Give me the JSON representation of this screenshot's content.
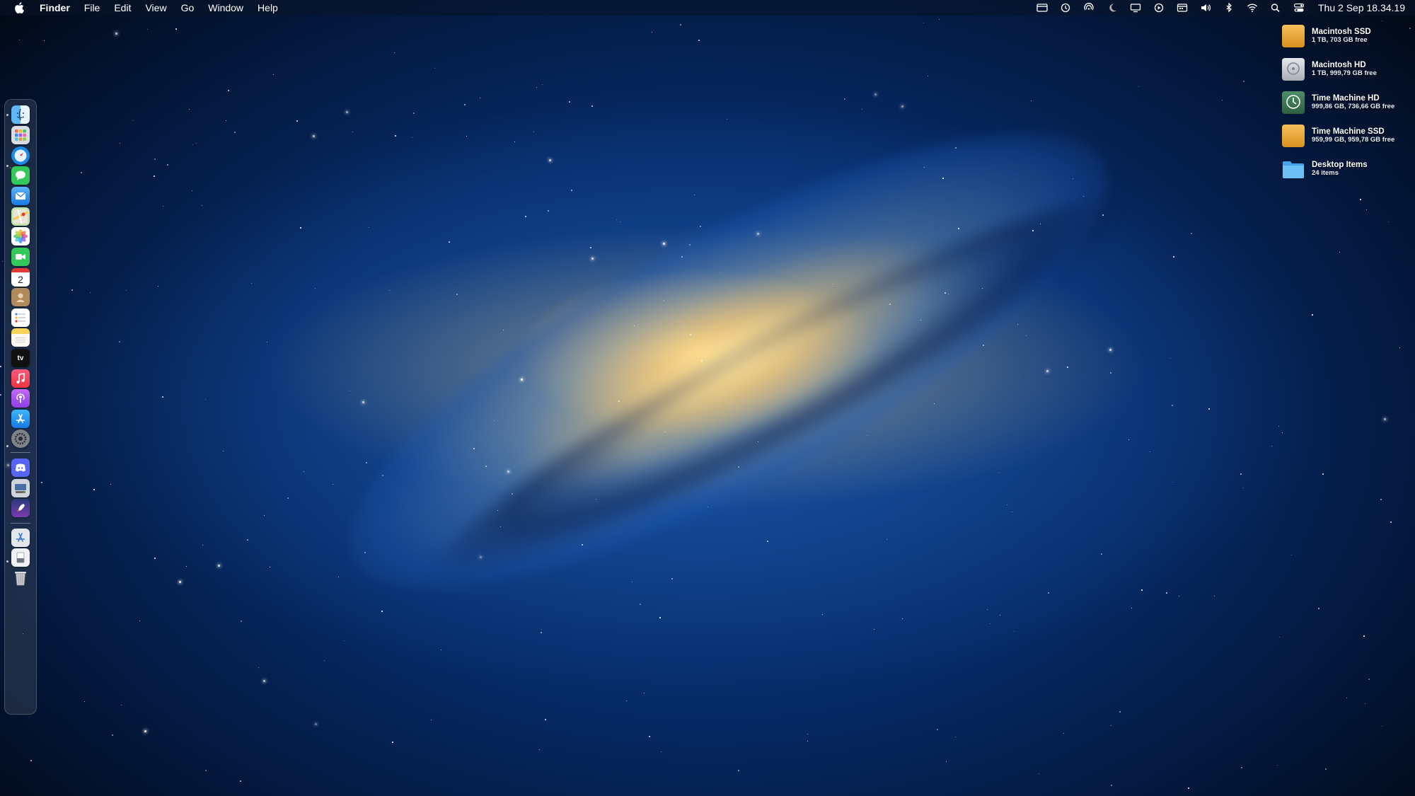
{
  "menubar": {
    "app_name": "Finder",
    "menus": [
      "File",
      "Edit",
      "View",
      "Go",
      "Window",
      "Help"
    ],
    "status_icons": [
      "window-icon",
      "time-machine-icon",
      "airdrop-icon",
      "moon-icon",
      "display-icon",
      "play-icon",
      "calendar-icon",
      "volume-icon",
      "bluetooth-icon",
      "wifi-icon",
      "search-icon",
      "control-center-icon"
    ],
    "clock": "Thu 2 Sep  18.34.19"
  },
  "dock": {
    "apps": [
      {
        "name": "finder",
        "icon": "finder-icon",
        "running": true
      },
      {
        "name": "launchpad",
        "icon": "launchpad-icon",
        "running": false
      },
      {
        "name": "safari",
        "icon": "safari-icon",
        "running": true
      },
      {
        "name": "messages",
        "icon": "messages-icon",
        "running": false
      },
      {
        "name": "mail",
        "icon": "mail-icon",
        "running": false
      },
      {
        "name": "maps",
        "icon": "maps-icon",
        "running": false
      },
      {
        "name": "photos",
        "icon": "photos-icon",
        "running": false
      },
      {
        "name": "facetime",
        "icon": "facetime-icon",
        "running": false
      },
      {
        "name": "calendar",
        "icon": "calendar-icon",
        "running": false,
        "day": "2"
      },
      {
        "name": "contacts",
        "icon": "contacts-icon",
        "running": false
      },
      {
        "name": "reminders",
        "icon": "reminders-icon",
        "running": false
      },
      {
        "name": "notes",
        "icon": "notes-icon",
        "running": false
      },
      {
        "name": "apple-tv",
        "icon": "apple-tv-icon",
        "running": false
      },
      {
        "name": "music",
        "icon": "music-icon",
        "running": true
      },
      {
        "name": "podcasts",
        "icon": "podcasts-icon",
        "running": false
      },
      {
        "name": "app-store",
        "icon": "app-store-icon",
        "running": false
      },
      {
        "name": "system-preferences",
        "icon": "gear-icon",
        "running": false
      }
    ],
    "extra_apps": [
      {
        "name": "discord",
        "icon": "discord-icon",
        "running": true
      },
      {
        "name": "disk-utility",
        "icon": "disk-icon",
        "running": false
      },
      {
        "name": "rocket",
        "icon": "rocket-icon",
        "running": false
      }
    ],
    "stacks": [
      {
        "name": "applications-folder",
        "icon": "app-folder-icon"
      },
      {
        "name": "documents-folder",
        "icon": "document-folder-icon"
      },
      {
        "name": "trash",
        "icon": "trash-icon"
      }
    ]
  },
  "desktop": {
    "items": [
      {
        "title": "Macintosh SSD",
        "subtitle": "1 TB, 703 GB free",
        "icon": "ssd-drive-icon",
        "color": "#e8a838"
      },
      {
        "title": "Macintosh HD",
        "subtitle": "1 TB, 999,79 GB free",
        "icon": "hard-drive-icon",
        "color": "#c9ccd1"
      },
      {
        "title": "Time Machine HD",
        "subtitle": "999,86 GB, 736,66 GB free",
        "icon": "time-machine-drive-icon",
        "color": "#3c7a55"
      },
      {
        "title": "Time Machine SSD",
        "subtitle": "959,99 GB, 959,78 GB free",
        "icon": "ssd-drive-icon",
        "color": "#e8a838"
      },
      {
        "title": "Desktop Items",
        "subtitle": "24 items",
        "icon": "folder-icon",
        "color": "#5fb3f0"
      }
    ]
  }
}
